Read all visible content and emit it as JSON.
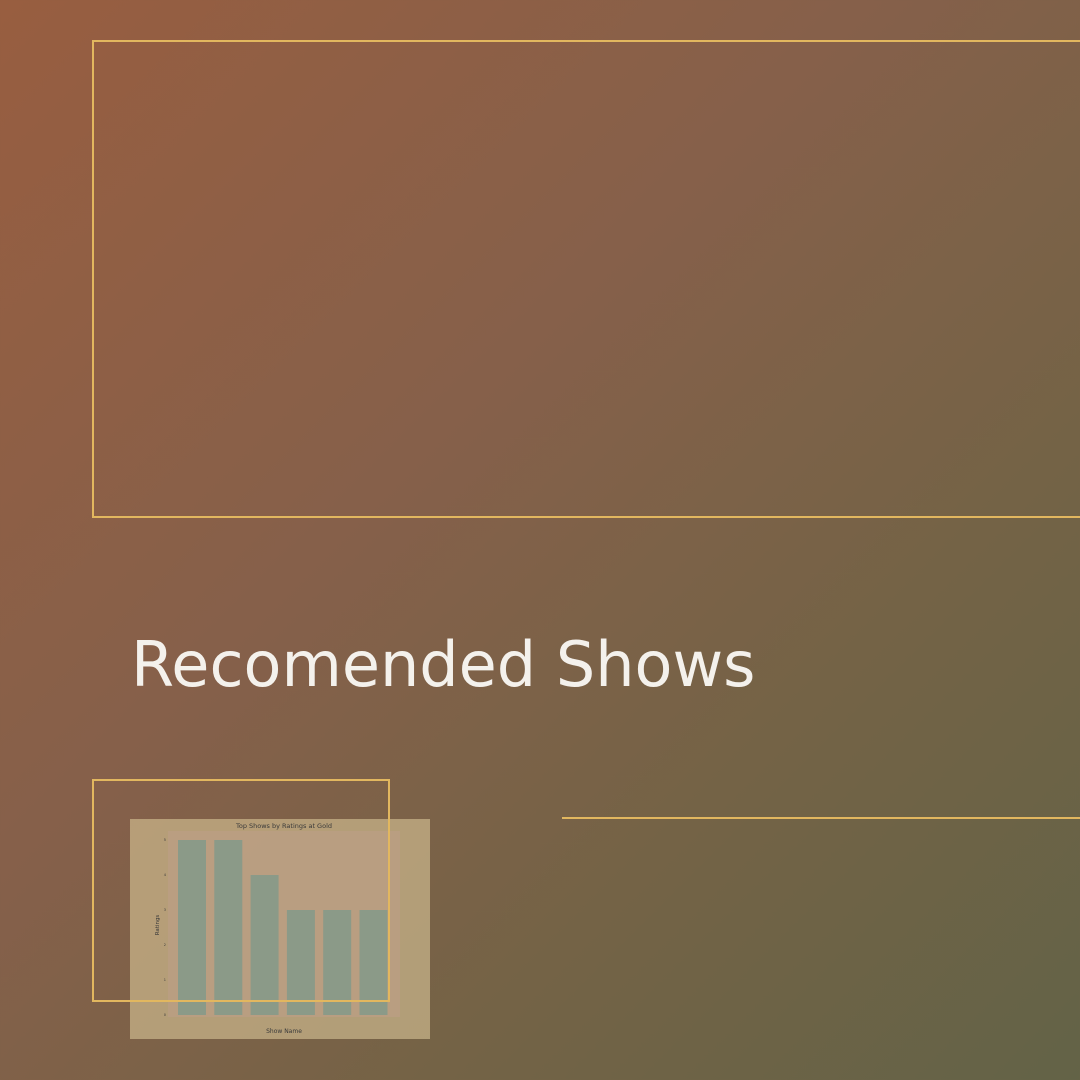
{
  "heading": "Recomended Shows",
  "colors": {
    "accent_line": "#e2b75f",
    "title_text": "#f4f1ec",
    "bar": "#8b9a88",
    "plot_bg": "#bb9e84"
  },
  "chart_data": {
    "type": "bar",
    "title": "Top Shows by Ratings at Gold",
    "xlabel": "Show Name",
    "ylabel": "Ratings",
    "categories": [
      "",
      "",
      "",
      "",
      "",
      ""
    ],
    "values": [
      5,
      5,
      4,
      3,
      3,
      3
    ],
    "ylim": [
      0,
      5
    ],
    "yticks": [
      0,
      1,
      2,
      3,
      4,
      5
    ],
    "grid": false
  }
}
